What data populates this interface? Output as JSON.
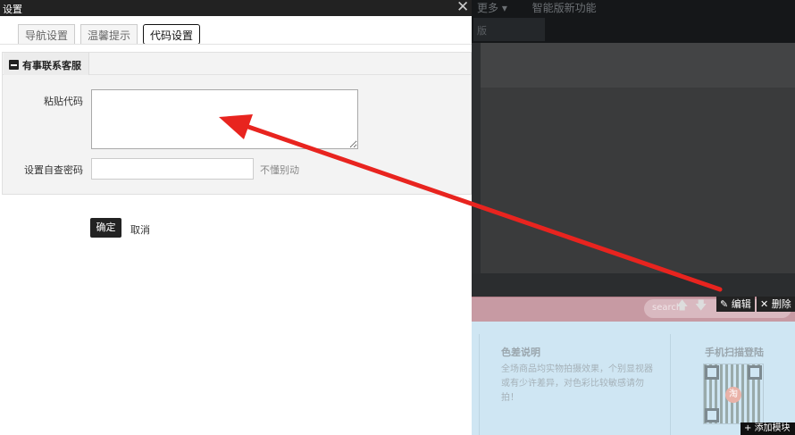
{
  "dialog": {
    "title": "设置",
    "close_glyph": "✕",
    "tabs": [
      {
        "label": "导航设置"
      },
      {
        "label": "温馨提示"
      },
      {
        "label": "代码设置"
      }
    ],
    "panel_tab_label": "有事联系客服",
    "code_label": "粘贴代码",
    "code_value": "",
    "password_label": "设置自查密码",
    "password_value": "",
    "password_hint": "不懂别动",
    "ok_label": "确定",
    "cancel_label": "取消"
  },
  "background": {
    "nav_more": "更多 ▾",
    "nav_new": "智能版新功能",
    "sub_label": "版",
    "search_placeholder": "search",
    "edit_label": "编辑",
    "delete_label": "删除",
    "add_module_label": "添加模块",
    "color_note_title": "色差说明",
    "color_note_text": "全场商品均实物拍摄效果，个别显视器或有少许差异，对色彩比较敏感请勿拍！",
    "qr_title": "手机扫描登陆",
    "qr_logo_text": "淘"
  },
  "colors": {
    "arrow": "#e8241f",
    "footer_bg": "#cfe6f3",
    "pink_bar": "#c79aa3"
  }
}
